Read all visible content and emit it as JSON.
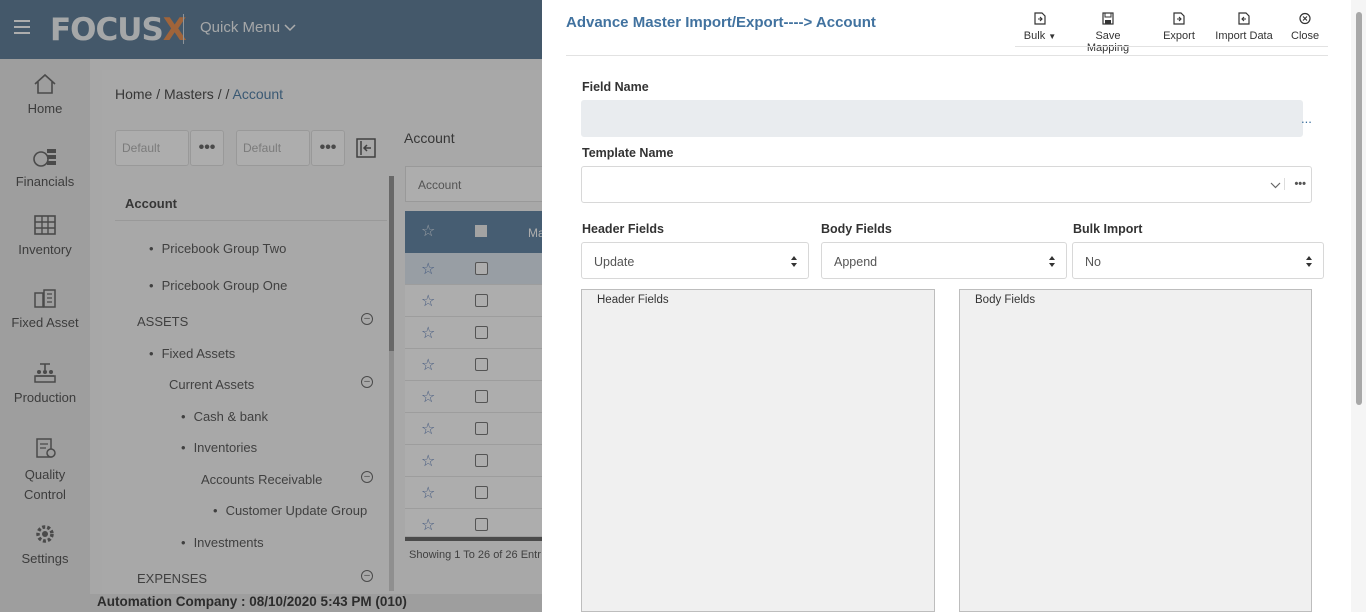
{
  "topbar": {
    "logo_text": "FOCUS",
    "logo_x": "X",
    "quick_menu": "Quick Menu"
  },
  "nav": [
    {
      "label": "Home",
      "icon": "home-icon"
    },
    {
      "label": "Financials",
      "icon": "financials-icon"
    },
    {
      "label": "Inventory",
      "icon": "inventory-icon"
    },
    {
      "label": "Fixed Asset",
      "icon": "fixed-asset-icon"
    },
    {
      "label": "Production",
      "icon": "production-icon"
    },
    {
      "label": "Quality Control",
      "icon": "quality-control-icon"
    },
    {
      "label": "Settings",
      "icon": "gear-icon"
    }
  ],
  "breadcrumb": {
    "path": "Home / Masters /  / ",
    "current": "Account"
  },
  "controls": {
    "default1": "Default",
    "default2": "Default",
    "dots": "•••"
  },
  "tree": {
    "title": "Account",
    "items": [
      "Pricebook Group Two",
      "Pricebook Group One",
      "ASSETS",
      "Fixed Assets",
      "Current Assets",
      "Cash & bank",
      "Inventories",
      "Accounts Receivable",
      "Customer Update Group",
      "Investments",
      "EXPENSES"
    ]
  },
  "grid": {
    "title": "Account",
    "filter": "Account",
    "header_ma": "Ma",
    "footer": "Showing 1 To 26 of 26 Entr"
  },
  "status": "Automation Company : 08/10/2020 5:43 PM (010)",
  "dialog": {
    "title": "Advance Master Import/Export----> Account",
    "toolbar": {
      "bulk": "Bulk",
      "save_mapping": "Save Mapping",
      "export": "Export",
      "import_data": "Import Data",
      "close": "Close"
    },
    "field_name_label": "Field Name",
    "field_name_value": "",
    "field_name_more": "...",
    "template_name_label": "Template Name",
    "template_name_value": "",
    "header_fields_label": "Header Fields",
    "header_fields_value": "Update",
    "body_fields_label": "Body Fields",
    "body_fields_value": "Append",
    "bulk_import_label": "Bulk Import",
    "bulk_import_value": "No",
    "header_box_title": "Header Fields",
    "body_box_title": "Body Fields"
  },
  "colors": {
    "topbar": "#4a6d8c",
    "accent": "#41729f",
    "logo_x": "#e9823a"
  }
}
